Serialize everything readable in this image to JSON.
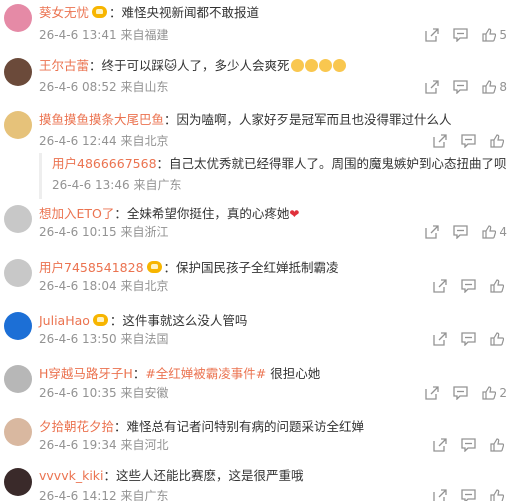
{
  "comments": [
    {
      "name": "葵女无忧",
      "vip": true,
      "text": "：难怪央视新闻都不敢报道",
      "date": "26-4-6 13:41",
      "location": "来自福建",
      "likes": "5",
      "avatar_color": "#e58aa6"
    },
    {
      "name": "王尔古蕾",
      "vip": false,
      "text": "：终于可以踩🐱人了，多少人会爽死",
      "emoji_count": 4,
      "date": "26-4-6 08:52",
      "location": "来自山东",
      "likes": "8",
      "avatar_color": "#6b4a3a"
    },
    {
      "name": "摸鱼摸鱼摸条大尾巴鱼",
      "vip": false,
      "text": "：因为嗑啊，人家好歹是冠军而且也没得罪过什么人",
      "date": "26-4-6 12:44",
      "location": "来自北京",
      "likes": "",
      "avatar_color": "#e6c27a",
      "reply": {
        "name": "用户4866667568",
        "text": "：自己太优秀就已经得罪人了。周围的魔鬼嫉妒到心态扭曲了呗",
        "date": "26-4-6 13:46",
        "location": "来自广东"
      }
    },
    {
      "name": "想加入ETO了",
      "vip": false,
      "text": "：全妹希望你挺住，真的心疼她",
      "heart": "❤",
      "date": "26-4-6 10:15",
      "location": "来自浙江",
      "likes": "4",
      "avatar_color": "#c8c8c8"
    },
    {
      "name": "用户7458541828",
      "vip": true,
      "text": "：保护国民孩子全红婵抵制霸凌",
      "date": "26-4-6 18:04",
      "location": "来自北京",
      "likes": "",
      "avatar_color": "#c8c8c8"
    },
    {
      "name": "JuliaHao",
      "vip": true,
      "text": "：这件事就这么没人管吗",
      "date": "26-4-6 13:50",
      "location": "来自法国",
      "likes": "",
      "avatar_color": "#1c6fd6"
    },
    {
      "name": "H穿越马路牙子H",
      "vip": false,
      "text_parts": [
        "：",
        "#全红婵被霸凌事件#",
        " 很担心她"
      ],
      "date": "26-4-6 10:35",
      "location": "来自安徽",
      "likes": "2",
      "avatar_color": "#b7b7b7"
    },
    {
      "name": "夕拾朝花夕拾",
      "vip": false,
      "text": "：难怪总有记者问特别有病的问题采访全红婵",
      "date": "26-4-6 19:34",
      "location": "来自河北",
      "likes": "",
      "avatar_color": "#d9b8a0"
    },
    {
      "name": "vvvvk_kiki",
      "vip": false,
      "text": "：这些人还能比赛麽，这是很严重哦",
      "date": "26-4-6 14:12",
      "location": "来自广东",
      "likes": "",
      "avatar_color": "#3a2a2a"
    }
  ],
  "icons": {
    "share": "share-icon",
    "comment": "comment-icon",
    "like": "like-icon"
  },
  "colors": {
    "name": "#eb7350",
    "meta": "#939393",
    "text": "#333333"
  }
}
